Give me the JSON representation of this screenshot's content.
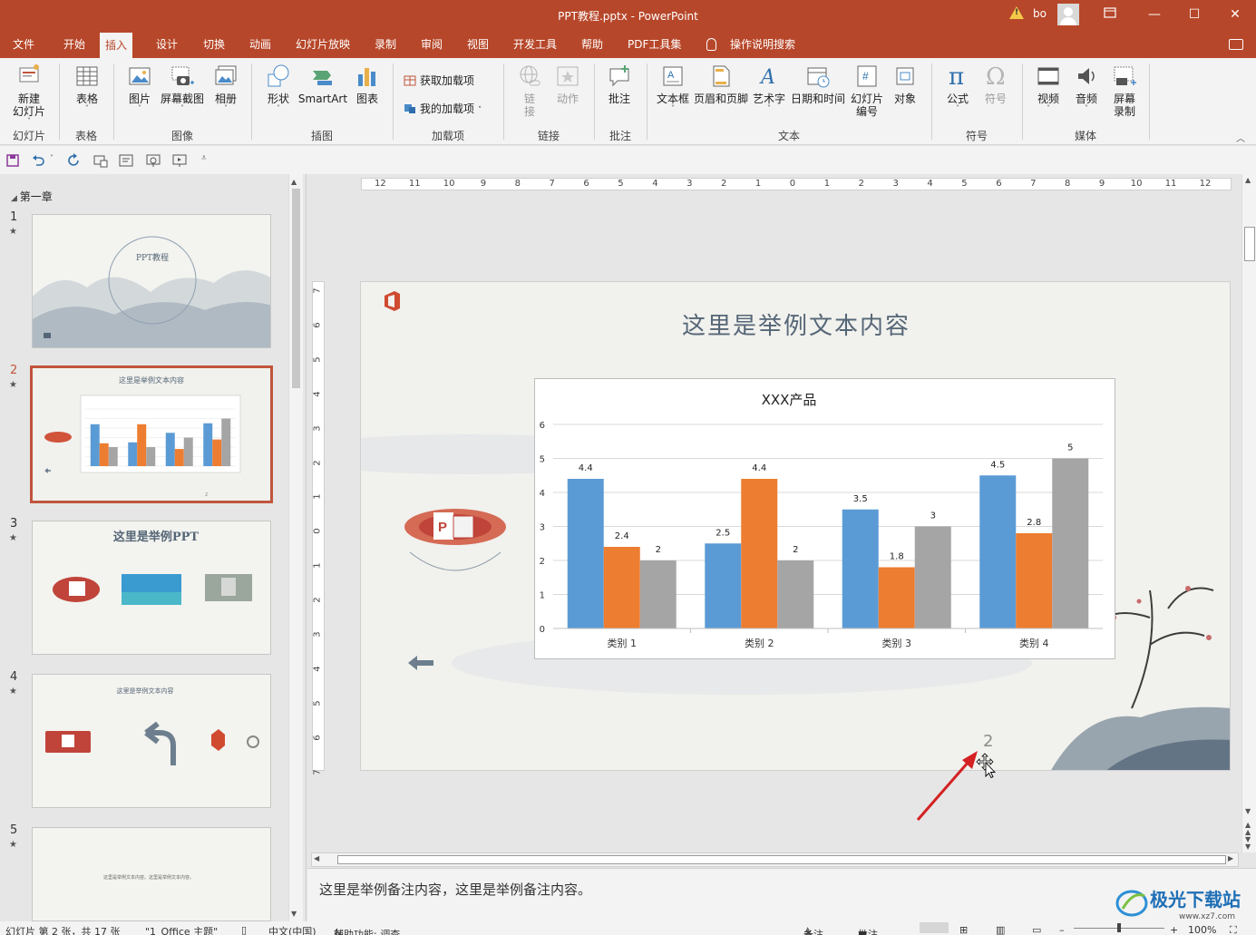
{
  "window": {
    "title": "PPT教程.pptx  -  PowerPoint",
    "user": "bo",
    "controls": [
      "restore-down",
      "minimize",
      "maximize",
      "close"
    ]
  },
  "tabs": [
    "文件",
    "开始",
    "插入",
    "设计",
    "切换",
    "动画",
    "幻灯片放映",
    "录制",
    "审阅",
    "视图",
    "开发工具",
    "帮助",
    "PDF工具集",
    "操作说明搜索"
  ],
  "active_tab": "插入",
  "ribbon": {
    "groups": [
      {
        "name": "幻灯片",
        "items": [
          "新建\n幻灯片"
        ]
      },
      {
        "name": "表格",
        "items": [
          "表格"
        ]
      },
      {
        "name": "图像",
        "items": [
          "图片",
          "屏幕截图",
          "相册"
        ]
      },
      {
        "name": "插图",
        "items": [
          "形状",
          "SmartArt",
          "图表"
        ]
      },
      {
        "name": "加载项",
        "items": [
          "获取加载项",
          "我的加载项"
        ]
      },
      {
        "name": "链接",
        "items": [
          "链\n接",
          "动作"
        ]
      },
      {
        "name": "批注",
        "items": [
          "批注"
        ]
      },
      {
        "name": "文本",
        "items": [
          "文本框",
          "页眉和页脚",
          "艺术字",
          "日期和时间",
          "幻灯片\n编号",
          "对象"
        ]
      },
      {
        "name": "符号",
        "items": [
          "公式",
          "符号"
        ]
      },
      {
        "name": "媒体",
        "items": [
          "视频",
          "音频",
          "屏幕\n录制"
        ]
      }
    ]
  },
  "slides_panel": {
    "section": "第一章",
    "thumbnails": [
      {
        "num": "1",
        "title": "PPT教程",
        "selected": false
      },
      {
        "num": "2",
        "title": "这里是举例文本内容",
        "selected": true
      },
      {
        "num": "3",
        "title": "这里是举例PPT",
        "selected": false
      },
      {
        "num": "4",
        "title": "这里是举例文本内容",
        "selected": false
      },
      {
        "num": "5",
        "title": "这里是举例文本内容。这里是举例文本内容。",
        "selected": false
      }
    ]
  },
  "slide": {
    "title": "这里是举例文本内容",
    "page_number": "2"
  },
  "ruler": {
    "h": [
      "12",
      "11",
      "10",
      "9",
      "8",
      "7",
      "6",
      "5",
      "4",
      "3",
      "2",
      "1",
      "0",
      "1",
      "2",
      "3",
      "4",
      "5",
      "6",
      "7",
      "8",
      "9",
      "10",
      "11",
      "12"
    ],
    "v": [
      "7",
      "6",
      "5",
      "4",
      "3",
      "2",
      "1",
      "0",
      "1",
      "2",
      "3",
      "4",
      "5",
      "6",
      "7"
    ]
  },
  "chart_data": {
    "type": "bar",
    "title": "XXX产品",
    "categories": [
      "类别 1",
      "类别 2",
      "类别 3",
      "类别 4"
    ],
    "series": [
      {
        "values": [
          4.4,
          2.5,
          3.5,
          4.5
        ],
        "color": "#5b9bd5"
      },
      {
        "values": [
          2.4,
          4.4,
          1.8,
          2.8
        ],
        "color": "#ed7d31"
      },
      {
        "values": [
          2,
          2,
          3,
          5
        ],
        "color": "#a5a5a5"
      }
    ],
    "ylim": [
      0,
      6
    ],
    "yticks": [
      0,
      1,
      2,
      3,
      4,
      5,
      6
    ],
    "grid": true,
    "legend": "none",
    "data_labels": true
  },
  "notes": "这里是举例备注内容，这里是举例备注内容。",
  "status": {
    "slide_info": "幻灯片 第 2 张，共 17 张",
    "theme": "\"1_Office 主题\"",
    "language": "中文(中国)",
    "accessibility": "辅助功能: 调查",
    "notes_btn": "备注",
    "comments_btn": "批注",
    "zoom": "100%"
  },
  "watermark": {
    "text": "极光下载站",
    "url_text": "www.xz7.com"
  },
  "colors": {
    "accent": "#b7472a",
    "selection": "#c0553b"
  }
}
